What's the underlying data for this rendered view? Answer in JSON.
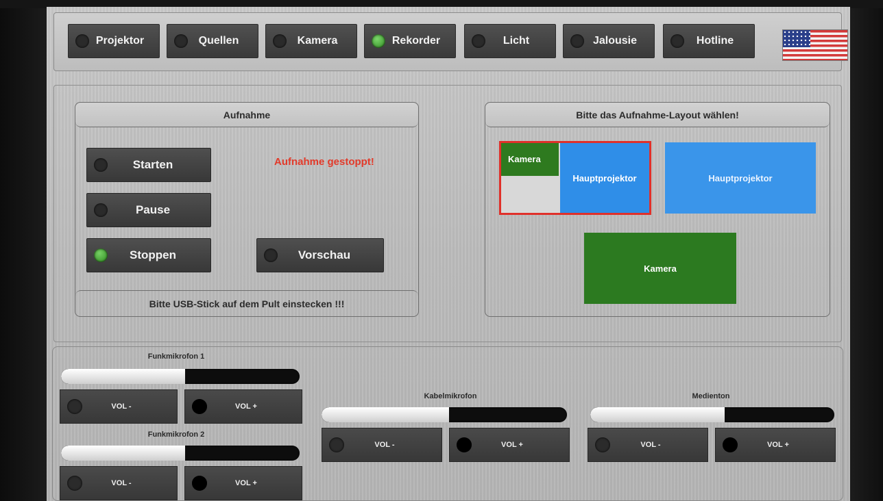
{
  "nav": {
    "items": [
      {
        "label": "Projektor",
        "active": false
      },
      {
        "label": "Quellen",
        "active": false
      },
      {
        "label": "Kamera",
        "active": false
      },
      {
        "label": "Rekorder",
        "active": true
      },
      {
        "label": "Licht",
        "active": false
      },
      {
        "label": "Jalousie",
        "active": false
      },
      {
        "label": "Hotline",
        "active": false
      }
    ],
    "language_flag": "us-flag-icon"
  },
  "recording": {
    "title": "Aufnahme",
    "status": "Aufnahme gestoppt!",
    "buttons": {
      "start": "Starten",
      "pause": "Pause",
      "stop": "Stoppen",
      "preview": "Vorschau"
    },
    "footer": "Bitte USB-Stick auf dem Pult einstecken !!!"
  },
  "layout": {
    "title": "Bitte das Aufnahme-Layout wählen!",
    "option1": {
      "camera": "Kamera",
      "projector": "Hauptprojektor"
    },
    "option2": {
      "projector": "Hauptprojektor"
    },
    "option3": {
      "camera": "Kamera"
    }
  },
  "audio": {
    "channels": [
      {
        "name": "Funkmikrofon 1",
        "level": 0.52,
        "vol_down": "VOL -",
        "vol_up": "VOL +"
      },
      {
        "name": "Funkmikrofon 2",
        "level": 0.52,
        "vol_down": "VOL -",
        "vol_up": "VOL +"
      },
      {
        "name": "Kabelmikrofon",
        "level": 0.52,
        "vol_down": "VOL -",
        "vol_up": "VOL +"
      },
      {
        "name": "Medienton",
        "level": 0.55,
        "vol_down": "VOL -",
        "vol_up": "VOL +"
      }
    ]
  },
  "colors": {
    "accent_green": "#2d8a1f",
    "status_red": "#e23a2a",
    "layout_selected_border": "#e0302a",
    "projector_blue": "#2f8ee8",
    "camera_green": "#2e7a1f"
  }
}
